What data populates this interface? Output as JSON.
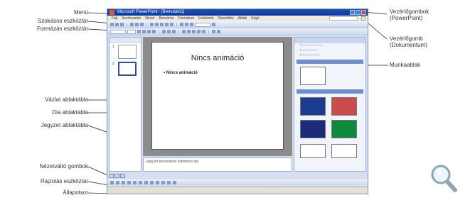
{
  "labels": {
    "menu": "Menü",
    "standard_toolbar": "Szokásos eszköztár",
    "formatting_toolbar": "Formázás eszköztár",
    "outline_tab": "Vázlat ablaktábla",
    "slide_pane": "Dia ablaktábla",
    "notes_pane": "Jegyzet ablaktábla",
    "view_buttons": "Nézetváltó gombok",
    "drawing_toolbar": "Rajzolás eszköztár",
    "status_bar": "Állapotsor",
    "app_control_line1": "Vezérlőgombok",
    "app_control_line2": "(PowerPoint)",
    "doc_control_line1": "Vezérlőgomb",
    "doc_control_line2": "(Dokumentum)",
    "task_pane": "Munkaablak"
  },
  "window": {
    "title": "Microsoft PowerPoint - [Bemutató1]",
    "menus": [
      "Fájl",
      "Szerkesztés",
      "Nézet",
      "Beszúrás",
      "Formátum",
      "Eszközök",
      "Diavetítés",
      "Ablak",
      "Súgó"
    ],
    "slide_title": "Nincs animáció",
    "slide_bullet": "• Nincs animáció",
    "notes_placeholder": "Jegyzet beírásához kattintson ide",
    "thumb_numbers": [
      "1",
      "2"
    ]
  },
  "icons": {
    "zoom": "magnifier-icon"
  },
  "colors": {
    "titlebar": "#0b3aa0",
    "slide_background": "#ffffff",
    "stage_gray": "#8c8c8c"
  }
}
